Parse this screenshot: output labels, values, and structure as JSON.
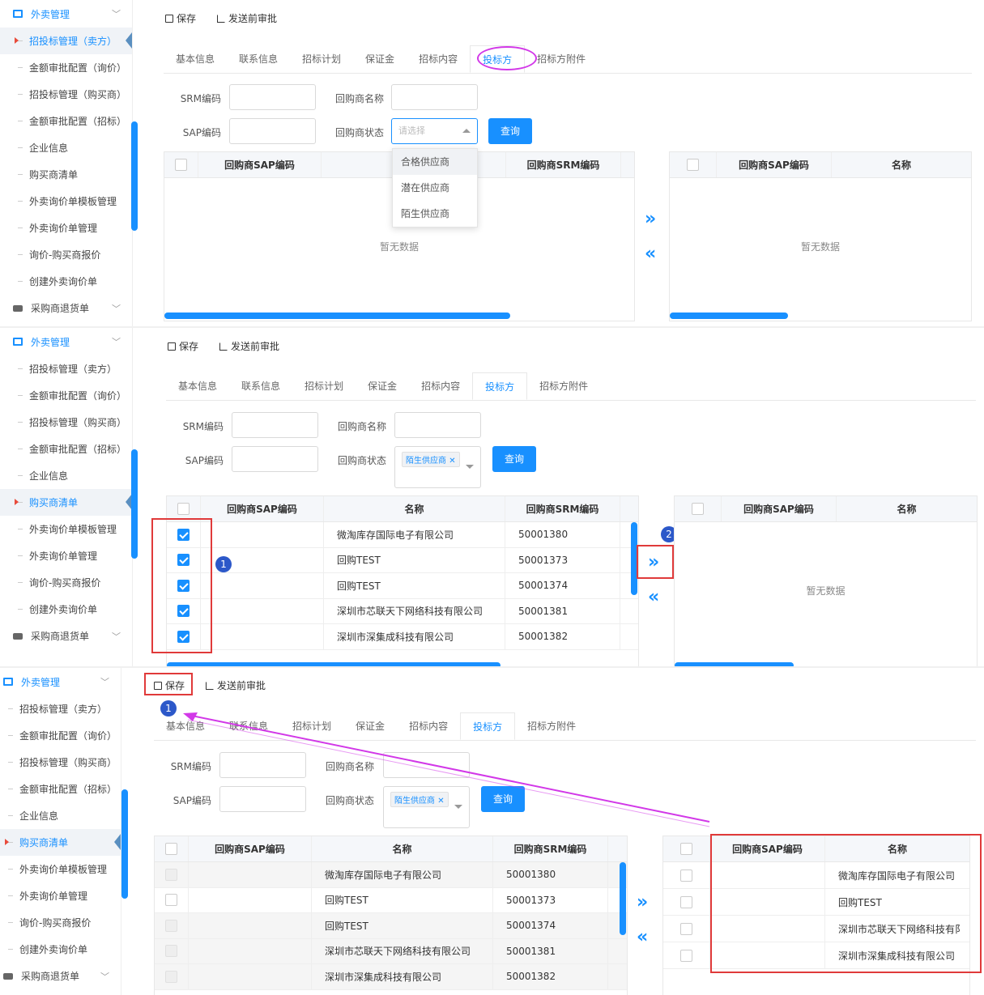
{
  "sidebar": {
    "section": "外卖管理",
    "items": [
      "招投标管理（卖方）",
      "金额审批配置（询价）",
      "招投标管理（购买商）",
      "金额审批配置（招标）",
      "企业信息",
      "购买商清单",
      "外卖询价单模板管理",
      "外卖询价单管理",
      "询价-购买商报价",
      "创建外卖询价单"
    ],
    "footer": "采购商退货单"
  },
  "toolbar": {
    "save": "保存",
    "submit": "发送前审批"
  },
  "tabs": [
    "基本信息",
    "联系信息",
    "招标计划",
    "保证金",
    "招标内容",
    "投标方",
    "招标方附件"
  ],
  "form": {
    "srm_label": "SRM编码",
    "name_label": "回购商名称",
    "sap_label": "SAP编码",
    "status_label": "回购商状态",
    "status_placeholder": "请选择",
    "status_selected": "陌生供应商",
    "query": "查询"
  },
  "dropdown": [
    "合格供应商",
    "潜在供应商",
    "陌生供应商"
  ],
  "left_grid": {
    "headers": [
      "回购商SAP编码",
      "名称",
      "回购商SRM编码"
    ]
  },
  "right_grid": {
    "headers": [
      "回购商SAP编码",
      "名称"
    ]
  },
  "empty_text": "暂无数据",
  "rows": [
    {
      "name": "微淘库存国际电子有限公司",
      "srm": "50001380"
    },
    {
      "name": "回购TEST",
      "srm": "50001373"
    },
    {
      "name": "回购TEST",
      "srm": "50001374"
    },
    {
      "name": "深圳市芯联天下网络科技有限公司",
      "srm": "50001381"
    },
    {
      "name": "深圳市深集成科技有限公司",
      "srm": "50001382"
    }
  ],
  "right_rows": [
    "微淘库存国际电子有限公司",
    "回购TEST",
    "深圳市芯联天下网络科技有阝",
    "深圳市深集成科技有限公司"
  ],
  "arrows": {
    "right": "»",
    "left": "«"
  },
  "badges": [
    "1",
    "2"
  ],
  "colors": {
    "accent": "#1890ff",
    "annotation_red": "#e03a3a",
    "annotation_magenta": "#d238e8",
    "badge": "#2c58c9"
  }
}
